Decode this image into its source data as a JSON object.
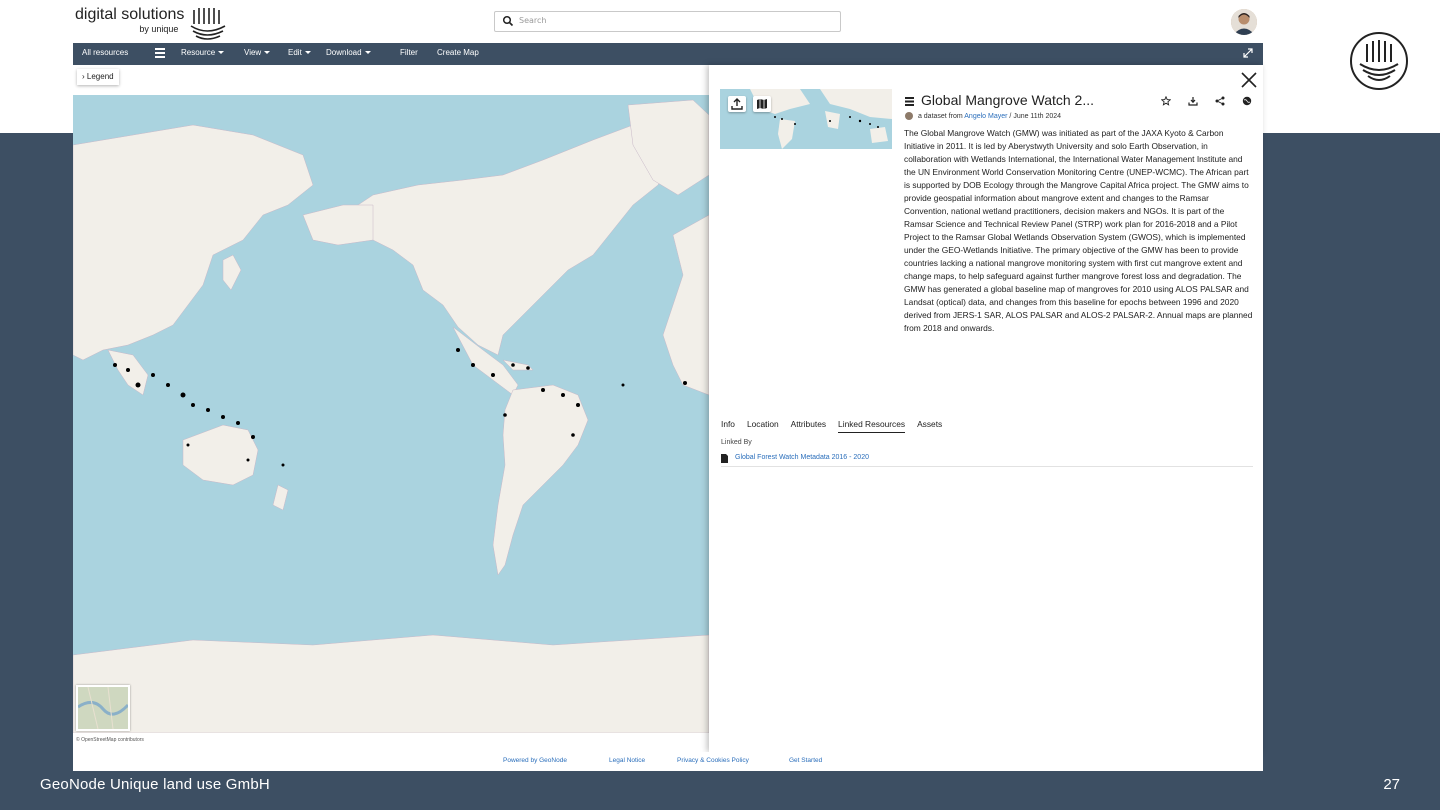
{
  "slide": {
    "footer_left": "GeoNode Unique land use GmbH",
    "page_number": "27"
  },
  "brand": {
    "main": "digital solutions",
    "sub": "by unique"
  },
  "search": {
    "placeholder": "Search"
  },
  "navbar": {
    "items": [
      {
        "label": "All resources",
        "dropdown": false
      },
      {
        "label": "",
        "icon": "catalog-icon"
      },
      {
        "label": "Resource",
        "dropdown": true
      },
      {
        "label": "View",
        "dropdown": true
      },
      {
        "label": "Edit",
        "dropdown": true
      },
      {
        "label": "Download",
        "dropdown": true
      },
      {
        "label": "Filter",
        "dropdown": false
      },
      {
        "label": "Create Map",
        "dropdown": false
      }
    ]
  },
  "map": {
    "legend_label": "Legend",
    "attribution": "© OpenStreetMap contributors"
  },
  "panel": {
    "title": "Global Mangrove Watch 2...",
    "byline_prefix": "a dataset from",
    "author": "Angelo Mayer",
    "date": "June 11th 2024",
    "description": "The Global Mangrove Watch (GMW) was initiated as part of the JAXA Kyoto & Carbon Initiative in 2011. It is led by Aberystwyth University and solo Earth Observation, in collaboration with Wetlands International, the International Water Management Institute and the UN Environment World Conservation Monitoring Centre (UNEP-WCMC). The African part is supported by DOB Ecology through the Mangrove Capital Africa project. The GMW aims to provide geospatial information about mangrove extent and changes to the Ramsar Convention, national wetland practitioners, decision makers and NGOs. It is part of the Ramsar Science and Technical Review Panel (STRP) work plan for 2016-2018 and a Pilot Project to the Ramsar Global Wetlands Observation System (GWOS), which is implemented under the GEO-Wetlands Initiative. The primary objective of the GMW has been to provide countries lacking a national mangrove monitoring system with first cut mangrove extent and change maps, to help safeguard against further mangrove forest loss and degradation. The GMW has generated a global baseline map of mangroves for 2010 using ALOS PALSAR and Landsat (optical) data, and changes from this baseline for epochs between 1996 and 2020 derived from JERS-1 SAR, ALOS PALSAR and ALOS-2 PALSAR-2. Annual maps are planned from 2018 and onwards.",
    "tabs": [
      "Info",
      "Location",
      "Attributes",
      "Linked Resources",
      "Assets"
    ],
    "active_tab": "Linked Resources",
    "linked_by_label": "Linked By",
    "linked_items": [
      "Global Forest Watch Metadata 2016 - 2020"
    ]
  },
  "app_footer": {
    "links": [
      "Powered by GeoNode",
      "Legal Notice",
      "Privacy & Cookies Policy",
      "Get Started"
    ]
  },
  "colors": {
    "navbar": "#3d4f63",
    "ocean": "#aad3df",
    "land": "#f2efe9",
    "mangrove": "#000000",
    "link": "#2a6ebb"
  }
}
